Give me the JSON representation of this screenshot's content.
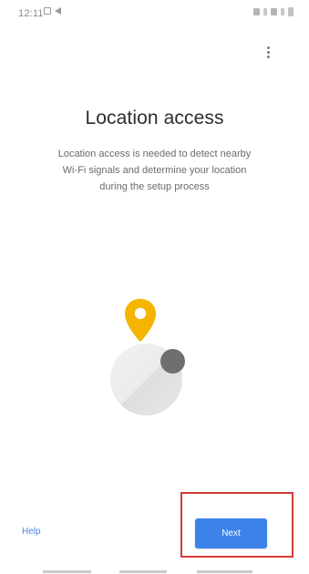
{
  "status_bar": {
    "time": "12:11"
  },
  "screen": {
    "title": "Location access",
    "description_lines": [
      "Location access is needed to detect nearby",
      "Wi-Fi signals and determine your location",
      "during the setup process"
    ]
  },
  "actions": {
    "help_label": "Help",
    "next_label": "Next"
  },
  "icons": {
    "more": "more-vert-icon",
    "location": "location-pin-icon"
  },
  "colors": {
    "background": "#ffffff",
    "title": "#2d2d2d",
    "body_text": "#6b6b6b",
    "link": "#4d86d7",
    "next_button": "#3c82ea",
    "pin": "#f5b400",
    "highlight_box": "#d33b3b"
  }
}
